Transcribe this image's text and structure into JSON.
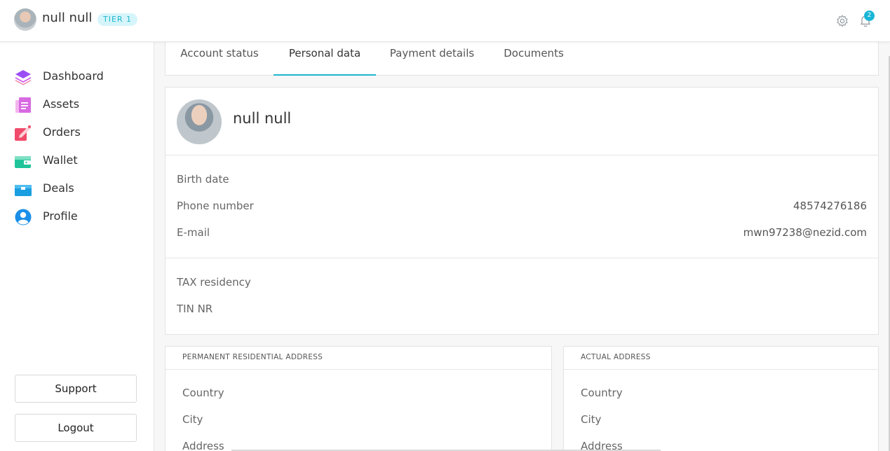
{
  "header": {
    "user_name": "null null",
    "tier_label": "TIER 1",
    "notification_count": "2",
    "icons": [
      "avatar",
      "gear-icon",
      "bell-icon"
    ]
  },
  "sidebar": {
    "items": [
      {
        "label": "Dashboard",
        "icon": "layers-icon"
      },
      {
        "label": "Assets",
        "icon": "document-icon"
      },
      {
        "label": "Orders",
        "icon": "pen-icon"
      },
      {
        "label": "Wallet",
        "icon": "wallet-icon"
      },
      {
        "label": "Deals",
        "icon": "briefcase-icon"
      },
      {
        "label": "Profile",
        "icon": "user-icon"
      }
    ],
    "support_label": "Support",
    "logout_label": "Logout"
  },
  "tabs": [
    "Account status",
    "Personal data",
    "Payment details",
    "Documents"
  ],
  "active_tab": "Personal data",
  "profile": {
    "name": "null null",
    "birth_date_label": "Birth date",
    "birth_date_value": "",
    "phone_label": "Phone number",
    "phone_value": "48574276186",
    "email_label": "E-mail",
    "email_value": "mwn97238@nezid.com",
    "tax_residency_label": "TAX residency",
    "tin_label": "TIN NR"
  },
  "permanent_address": {
    "title": "PERMANENT RESIDENTIAL ADDRESS",
    "country_label": "Country",
    "city_label": "City",
    "address_label": "Address"
  },
  "actual_address": {
    "title": "ACTUAL ADDRESS",
    "country_label": "Country",
    "city_label": "City",
    "address_label": "Address"
  },
  "colors": {
    "accent": "#1fb6cc",
    "tier_bg": "#d6f5fa",
    "dashboard_icon": "#8b3df0",
    "assets_icon": "#d66ae0",
    "orders_icon": "#f04a6a",
    "wallet_icon": "#20c79a",
    "deals_icon": "#1aa0e0",
    "profile_icon": "#1a8fe8"
  }
}
